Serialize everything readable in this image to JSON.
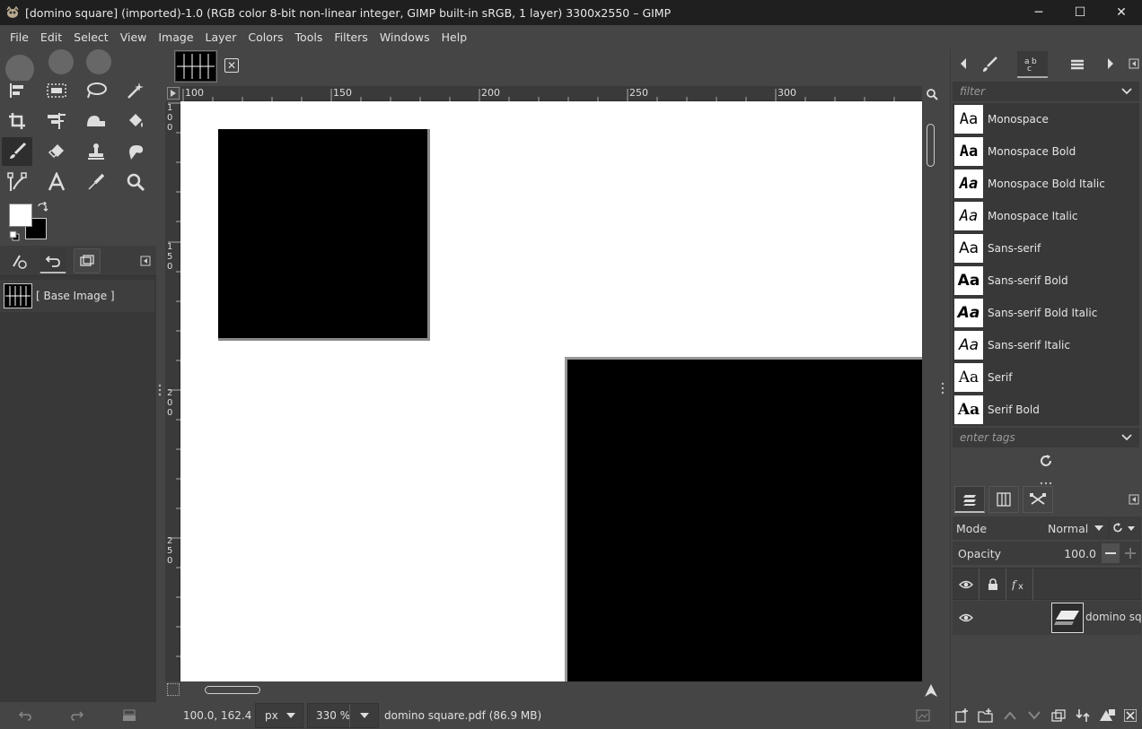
{
  "window": {
    "title": "[domino square] (imported)-1.0 (RGB color 8-bit non-linear integer, GIMP built-in sRGB, 1 layer) 3300x2550 – GIMP",
    "controls": {
      "minimize": "─",
      "maximize": "☐",
      "close": "✕"
    }
  },
  "menu": [
    "File",
    "Edit",
    "Select",
    "View",
    "Image",
    "Layer",
    "Colors",
    "Tools",
    "Filters",
    "Windows",
    "Help"
  ],
  "toolbox": {
    "tools": [
      "align-icon",
      "rect-select-icon",
      "lasso-icon",
      "fuzzy-select-icon",
      "crop-icon",
      "transform-icon",
      "warp-icon",
      "bucket-fill-icon",
      "paintbrush-icon",
      "eraser-icon",
      "clone-icon",
      "smudge-icon",
      "paths-icon",
      "text-icon",
      "color-picker-icon",
      "zoom-icon"
    ],
    "active_tool": "paintbrush-icon",
    "fg_color": "#ffffff",
    "bg_color": "#000000"
  },
  "images_panel": {
    "items": [
      {
        "label": "[ Base Image ]"
      }
    ]
  },
  "rulers": {
    "horizontal": [
      "100",
      "150",
      "200",
      "250",
      "300"
    ],
    "vertical": [
      [
        "1",
        "0",
        "0"
      ],
      [
        "1",
        "5",
        "0"
      ],
      [
        "2",
        "0",
        "0"
      ],
      [
        "2",
        "5",
        "0"
      ]
    ]
  },
  "status": {
    "coords": "100.0, 162.4",
    "unit": "px",
    "zoom": "330 %",
    "file": "domino square.pdf (86.9 MB)"
  },
  "fonts_panel": {
    "filter_placeholder": "filter",
    "tags_placeholder": "enter tags",
    "preview_text": "Aa",
    "fonts": [
      {
        "name": "Monospace",
        "style": "mono"
      },
      {
        "name": "Monospace Bold",
        "style": "mono-bold"
      },
      {
        "name": "Monospace Bold Italic",
        "style": "mono-bold-italic"
      },
      {
        "name": "Monospace Italic",
        "style": "mono-italic"
      },
      {
        "name": "Sans-serif",
        "style": "sans"
      },
      {
        "name": "Sans-serif Bold",
        "style": "sans-bold"
      },
      {
        "name": "Sans-serif Bold Italic",
        "style": "sans-bold-italic"
      },
      {
        "name": "Sans-serif Italic",
        "style": "sans-italic"
      },
      {
        "name": "Serif",
        "style": "serif"
      },
      {
        "name": "Serif Bold",
        "style": "serif-bold"
      }
    ]
  },
  "layers_panel": {
    "mode_label": "Mode",
    "mode_value": "Normal",
    "opacity_label": "Opacity",
    "opacity_value": "100.0",
    "layers": [
      {
        "name": "domino squ",
        "visible": true
      }
    ]
  }
}
